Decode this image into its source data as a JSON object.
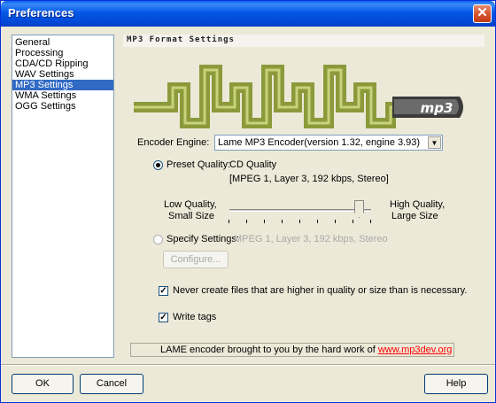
{
  "window": {
    "title": "Preferences",
    "close_glyph": "✕"
  },
  "sidebar": {
    "items": [
      {
        "label": "General"
      },
      {
        "label": "Processing"
      },
      {
        "label": "CDA/CD Ripping"
      },
      {
        "label": "WAV Settings"
      },
      {
        "label": "MP3 Settings",
        "selected": true
      },
      {
        "label": "WMA Settings"
      },
      {
        "label": "OGG Settings"
      }
    ]
  },
  "panel": {
    "header": "MP3 Format Settings",
    "logo_text": "mp3",
    "encoder_engine": {
      "label": "Encoder Engine:",
      "value": "Lame MP3 Encoder(version 1.32, engine 3.93)"
    },
    "preset": {
      "label": "Preset Quality:",
      "value": "CD Quality",
      "detail": "[MPEG 1, Layer 3, 192 kbps, Stereo]",
      "selected": true
    },
    "quality_slider": {
      "low_label_1": "Low Quality,",
      "low_label_2": "Small Size",
      "high_label_1": "High Quality,",
      "high_label_2": "Large Size",
      "value_fraction": 0.9
    },
    "specify": {
      "label": "Specify Settings:",
      "value": "MPEG 1, Layer 3, 192 kbps, Stereo",
      "selected": false
    },
    "configure_button": "Configure...",
    "never_create": {
      "label": "Never create files that are higher in quality or size than is necessary.",
      "checked": true
    },
    "write_tags": {
      "label": "Write tags",
      "checked": true
    },
    "credit": {
      "text": "LAME encoder brought to you by the hard work of",
      "link": "www.mp3dev.org"
    }
  },
  "footer": {
    "ok": "OK",
    "cancel": "Cancel",
    "help": "Help"
  },
  "colors": {
    "titlebar": "#0458e6",
    "selection": "#316ac5",
    "logo_green": "#8b9a3a",
    "logo_dark": "#3a3a3a",
    "link": "#ff0000"
  }
}
